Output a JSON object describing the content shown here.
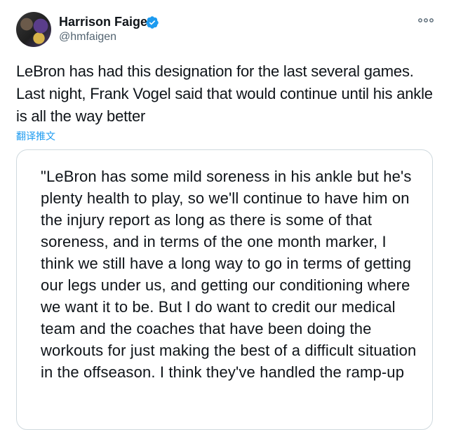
{
  "author": {
    "name": "Harrison Faigen",
    "handle": "@hmfaigen"
  },
  "colors": {
    "verified_badge": "#1d9bf0",
    "link": "#1d9bf0",
    "secondary_text": "#536471",
    "card_border": "#cfd9de"
  },
  "tweet": {
    "text": "LeBron has had this designation for the last several games. Last night, Frank Vogel said that would continue until his ankle is all the way better",
    "translate_label": "翻译推文"
  },
  "quote": {
    "text": "\"LeBron has some mild soreness in his ankle but he's plenty health to play, so we'll continue to have him on the injury report as long as there is some of that soreness, and in terms of the one month marker, I think we still have a long way to go in terms of getting our legs under us, and getting our conditioning where we want it to be. But I do want to credit our medical team and the coaches that have been doing the workouts for just making the best of a difficult situation in the offseason. I think they've handled the ramp-up"
  },
  "icons": {
    "avatar": "profile-photo",
    "verified": "verified-badge-icon",
    "more": "more-options-icon"
  }
}
